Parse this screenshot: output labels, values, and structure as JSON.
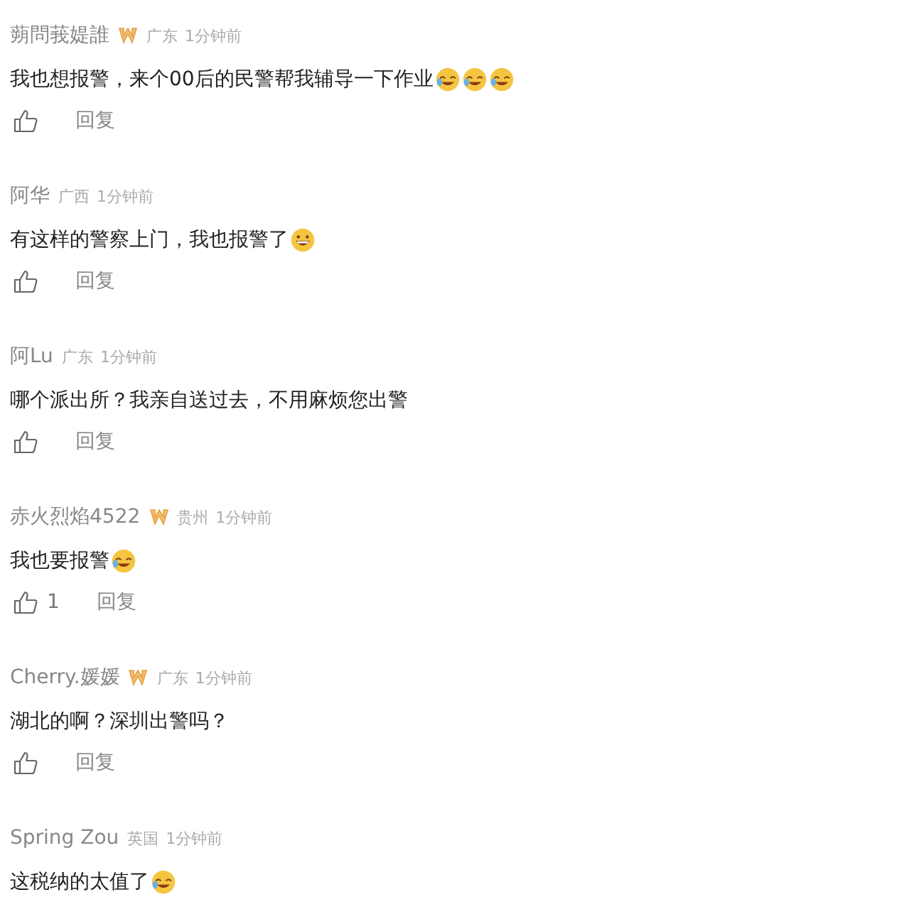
{
  "comments": [
    {
      "name": "蒴問莪媞誰",
      "verified": true,
      "location": "广东",
      "time": "1分钟前",
      "text": "我也想报警，来个00后的民警帮我辅导一下作业",
      "emojis": [
        {
          "kind": "tears"
        },
        {
          "kind": "tears"
        },
        {
          "kind": "tears"
        }
      ],
      "actions": {
        "reply": "回复"
      }
    },
    {
      "name": "阿华",
      "verified": false,
      "location": "广西",
      "time": "1分钟前",
      "text": "有这样的警察上门，我也报警了",
      "emojis": [
        {
          "kind": "grin"
        }
      ],
      "actions": {
        "reply": "回复"
      }
    },
    {
      "name": "阿Lu",
      "verified": false,
      "location": "广东",
      "time": "1分钟前",
      "text": "哪个派出所？我亲自送过去，不用麻烦您出警",
      "actions": {
        "reply": "回复"
      }
    },
    {
      "name": "赤火烈焰4522",
      "verified": true,
      "location": "贵州",
      "time": "1分钟前",
      "text": "我也要报警",
      "emojis": [
        {
          "kind": "tears"
        }
      ],
      "actions": {
        "likes": "1",
        "reply": "回复"
      }
    },
    {
      "name": "Cherry.媛媛",
      "verified": true,
      "location": "广东",
      "time": "1分钟前",
      "text": "湖北的啊？深圳出警吗？",
      "actions": {
        "reply": "回复"
      }
    },
    {
      "name": "Spring Zou",
      "verified": false,
      "location": "英国",
      "time": "1分钟前",
      "text": "这税纳的太值了",
      "emojis": [
        {
          "kind": "tears"
        }
      ]
    }
  ]
}
